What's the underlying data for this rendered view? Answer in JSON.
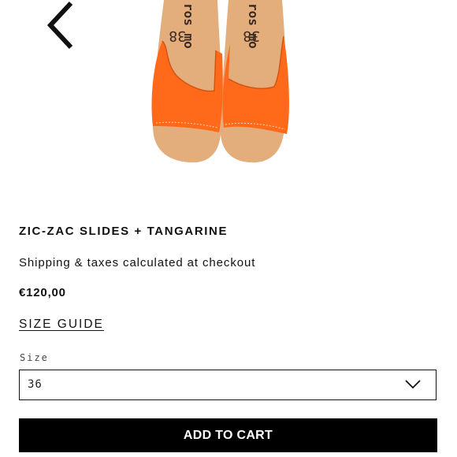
{
  "navigation": {
    "back_icon": "chevron-left-icon"
  },
  "product_image": {
    "imprint_left": "ros mo",
    "imprint_right": "ros mo",
    "size_mark": "38",
    "strap_color": "#ff6a1a",
    "sole_color": "#e3ad7c"
  },
  "product": {
    "title": "ZIC-ZAC SLIDES + TANGARINE",
    "shipping_note": "Shipping & taxes calculated at checkout",
    "price": "€120,00",
    "size_guide_label": "SIZE GUIDE"
  },
  "size_selector": {
    "label": "Size",
    "selected": "36",
    "icon": "chevron-down-icon"
  },
  "actions": {
    "add_to_cart_label": "ADD TO CART"
  }
}
